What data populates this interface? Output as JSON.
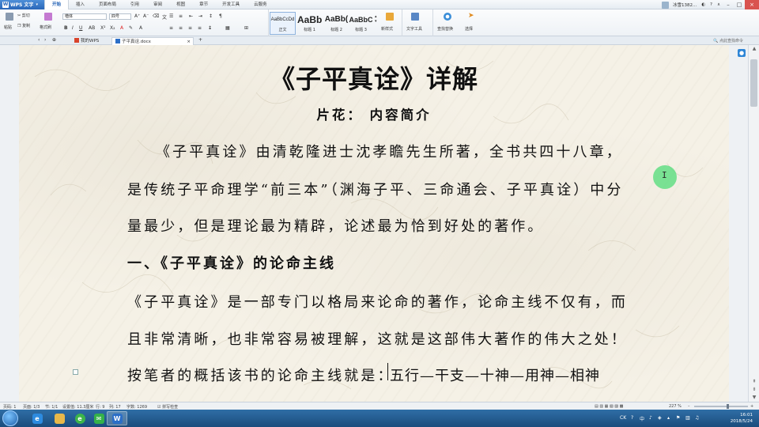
{
  "menubar": {
    "app_name": "WPS 文字",
    "tabs": [
      "开始",
      "插入",
      "页面布局",
      "引用",
      "审阅",
      "视图",
      "章节",
      "开发工具",
      "云服务"
    ],
    "active_tab": "开始",
    "user": "冰雪1382..."
  },
  "ribbon": {
    "paste": "粘贴",
    "cut": "剪切",
    "copy": "复制",
    "format_painter": "格式刷",
    "font_name": "楷体",
    "font_size": "四号",
    "styles": [
      {
        "preview": "AaBbCcDd",
        "name": "正文"
      },
      {
        "preview": "AaBb",
        "name": "标题 1"
      },
      {
        "preview": "AaBb(",
        "name": "标题 2"
      },
      {
        "preview": "AaBbC",
        "name": "标题 3"
      }
    ],
    "new_style": "新样式",
    "text_tools": "文字工具",
    "find_replace": "查找替换",
    "select": "选择",
    "search_hint": "点此查找命令"
  },
  "tabs": {
    "home": "我的WPS",
    "document": "子平真诠.docx"
  },
  "document": {
    "title": "《子平真诠》详解",
    "subtitle": "片花：  内容简介",
    "p1_line1": "《子平真诠》由清乾隆进士沈孝瞻先生所著，全书共四十八章，",
    "p1_line2": "是传统子平命理学“前三本”（渊海子平、三命通会、子平真诠）中分",
    "p1_line3": "量最少，但是理论最为精辟，论述最为恰到好处的著作。",
    "heading1": "一、《子平真诠》的论命主线",
    "p2_line1": "《子平真诠》是一部专门以格局来论命的著作，论命主线不仅有，而",
    "p2_line2": "且非常清晰，也非常容易被理解，这就是这部伟大著作的伟大之处！",
    "p3_before_caret": "按笔者的概括该书的论命主线就是：",
    "p3_after_caret": "五行—干支—十神—用神—相神",
    "cursor_letter": "I"
  },
  "statusbar": {
    "page": "页码: 1",
    "pages": "页面: 1/3",
    "section": "节: 1/1",
    "setting": "设置值: 11.3厘米",
    "row": "行: 9",
    "col": "列: 17",
    "words": "字数: 1269",
    "spell": "拼写检查",
    "zoom": "227 %",
    "zoom_fraction": 0.62
  },
  "taskbar": {
    "time": "16:01",
    "date": "2018/5/24",
    "lang": "CK"
  }
}
